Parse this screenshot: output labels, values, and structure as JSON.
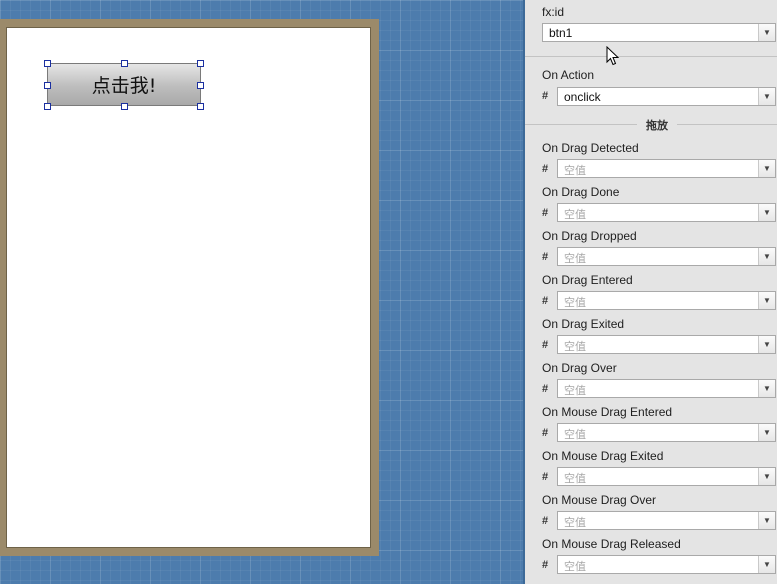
{
  "canvas": {
    "button_text": "点击我!"
  },
  "inspector": {
    "fxid": {
      "label": "fx:id",
      "value": "btn1"
    },
    "on_action": {
      "label": "On Action",
      "hash": "#",
      "value": "onclick"
    },
    "section_title": "拖放",
    "drag_fields": [
      {
        "label": "On Drag Detected",
        "hash": "#",
        "placeholder": "空值"
      },
      {
        "label": "On Drag Done",
        "hash": "#",
        "placeholder": "空值"
      },
      {
        "label": "On Drag Dropped",
        "hash": "#",
        "placeholder": "空值"
      },
      {
        "label": "On Drag Entered",
        "hash": "#",
        "placeholder": "空值"
      },
      {
        "label": "On Drag Exited",
        "hash": "#",
        "placeholder": "空值"
      },
      {
        "label": "On Drag Over",
        "hash": "#",
        "placeholder": "空值"
      },
      {
        "label": "On Mouse Drag Entered",
        "hash": "#",
        "placeholder": "空值"
      },
      {
        "label": "On Mouse Drag Exited",
        "hash": "#",
        "placeholder": "空值"
      },
      {
        "label": "On Mouse Drag Over",
        "hash": "#",
        "placeholder": "空值"
      },
      {
        "label": "On Mouse Drag Released",
        "hash": "#",
        "placeholder": "空值"
      }
    ]
  },
  "icons": {
    "dropdown": "chevron-down-icon",
    "cursor": "mouse-pointer-icon"
  }
}
